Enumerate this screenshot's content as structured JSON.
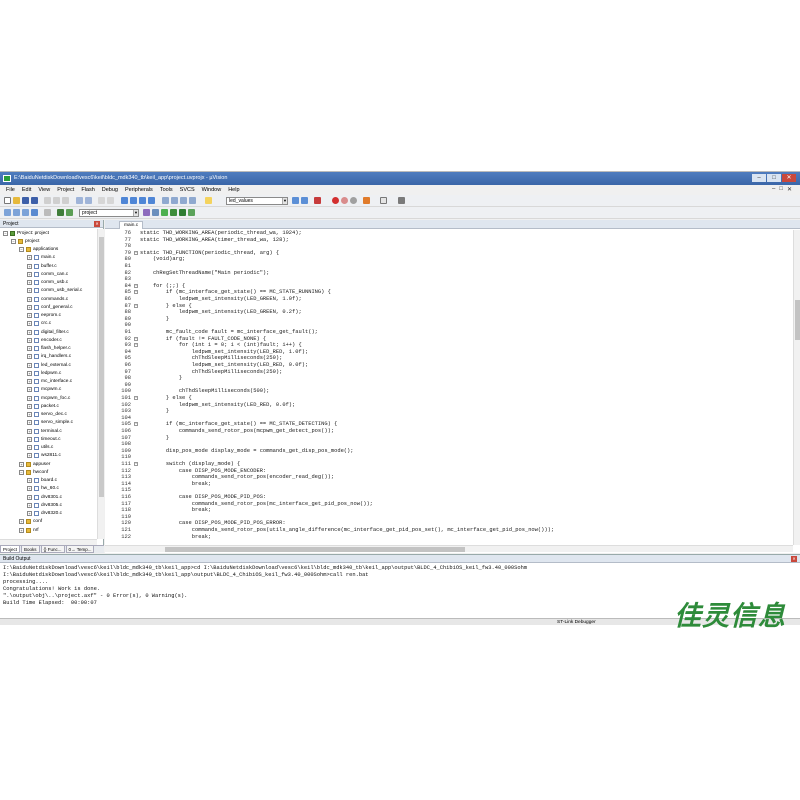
{
  "window": {
    "title": "E:\\BaiduNetdiskDownload\\vesc6\\keil\\bldc_mdk340_tb\\keil_app\\project.uvprojx - µVision",
    "controls": [
      "–",
      "□",
      "✕"
    ],
    "mdi_controls": [
      "–",
      "□",
      "✕"
    ]
  },
  "menu": [
    "File",
    "Edit",
    "View",
    "Project",
    "Flash",
    "Debug",
    "Peripherals",
    "Tools",
    "SVCS",
    "Window",
    "Help"
  ],
  "toolbar": {
    "find_value": "led_values",
    "target_value": "project"
  },
  "project_panel": {
    "title": "Project",
    "tree": [
      {
        "label": "Project: project",
        "level": 0,
        "icon": "proj-icon",
        "expander": "−"
      },
      {
        "label": "project",
        "level": 1,
        "icon": "folder-icon",
        "expander": "−"
      },
      {
        "label": "applications",
        "level": 2,
        "icon": "folder-icon",
        "expander": "−"
      },
      {
        "label": "main.c",
        "level": 3,
        "icon": "file-icon",
        "expander": "+"
      },
      {
        "label": "buffer.c",
        "level": 3,
        "icon": "file-icon",
        "expander": "+"
      },
      {
        "label": "comm_can.c",
        "level": 3,
        "icon": "file-icon",
        "expander": "+"
      },
      {
        "label": "comm_usb.c",
        "level": 3,
        "icon": "file-icon",
        "expander": "+"
      },
      {
        "label": "comm_usb_serial.c",
        "level": 3,
        "icon": "file-icon",
        "expander": "+"
      },
      {
        "label": "commands.c",
        "level": 3,
        "icon": "file-icon",
        "expander": "+"
      },
      {
        "label": "conf_general.c",
        "level": 3,
        "icon": "file-icon",
        "expander": "+"
      },
      {
        "label": "eeprom.c",
        "level": 3,
        "icon": "file-icon",
        "expander": "+"
      },
      {
        "label": "crc.c",
        "level": 3,
        "icon": "file-icon",
        "expander": "+"
      },
      {
        "label": "digital_filter.c",
        "level": 3,
        "icon": "file-icon",
        "expander": "+"
      },
      {
        "label": "encoder.c",
        "level": 3,
        "icon": "file-icon",
        "expander": "+"
      },
      {
        "label": "flash_helper.c",
        "level": 3,
        "icon": "file-icon",
        "expander": "+"
      },
      {
        "label": "irq_handlers.c",
        "level": 3,
        "icon": "file-icon",
        "expander": "+"
      },
      {
        "label": "led_external.c",
        "level": 3,
        "icon": "file-icon",
        "expander": "+"
      },
      {
        "label": "ledpwm.c",
        "level": 3,
        "icon": "file-icon",
        "expander": "+"
      },
      {
        "label": "mc_interface.c",
        "level": 3,
        "icon": "file-icon",
        "expander": "+"
      },
      {
        "label": "mcpwm.c",
        "level": 3,
        "icon": "file-icon",
        "expander": "+"
      },
      {
        "label": "mcpwm_foc.c",
        "level": 3,
        "icon": "file-icon",
        "expander": "+"
      },
      {
        "label": "packet.c",
        "level": 3,
        "icon": "file-icon",
        "expander": "+"
      },
      {
        "label": "servo_dec.c",
        "level": 3,
        "icon": "file-icon",
        "expander": "+"
      },
      {
        "label": "servo_simple.c",
        "level": 3,
        "icon": "file-icon",
        "expander": "+"
      },
      {
        "label": "terminal.c",
        "level": 3,
        "icon": "file-icon",
        "expander": "+"
      },
      {
        "label": "timeout.c",
        "level": 3,
        "icon": "file-icon",
        "expander": "+"
      },
      {
        "label": "utils.c",
        "level": 3,
        "icon": "file-icon",
        "expander": "+"
      },
      {
        "label": "ws2811.c",
        "level": 3,
        "icon": "file-icon",
        "expander": "+"
      },
      {
        "label": "appuser",
        "level": 2,
        "icon": "folder-icon",
        "expander": "+"
      },
      {
        "label": "hwconf",
        "level": 2,
        "icon": "folder-icon",
        "expander": "−"
      },
      {
        "label": "board.c",
        "level": 3,
        "icon": "file-icon",
        "expander": "+"
      },
      {
        "label": "hw_60.c",
        "level": 3,
        "icon": "file-icon",
        "expander": "+"
      },
      {
        "label": "drv8301.c",
        "level": 3,
        "icon": "file-icon",
        "expander": "+"
      },
      {
        "label": "drv8305.c",
        "level": 3,
        "icon": "file-icon",
        "expander": "+"
      },
      {
        "label": "drv8320.c",
        "level": 3,
        "icon": "file-icon",
        "expander": "+"
      },
      {
        "label": "conf",
        "level": 2,
        "icon": "folder-icon",
        "expander": "+"
      },
      {
        "label": "nrf",
        "level": 2,
        "icon": "folder-icon",
        "expander": "+"
      }
    ],
    "tabs": [
      "Project",
      "Books",
      "{} Func...",
      "0→ Temp..."
    ]
  },
  "editor": {
    "active_tab": "main.c",
    "lines": [
      {
        "n": "76",
        "code": "static THD_WORKING_AREA(periodic_thread_wa, 1024);"
      },
      {
        "n": "77",
        "code": "static THD_WORKING_AREA(timer_thread_wa, 128);"
      },
      {
        "n": "78",
        "code": ""
      },
      {
        "n": "79",
        "code": "static THD_FUNCTION(periodic_thread, arg) {",
        "fold": "−"
      },
      {
        "n": "80",
        "code": "    (void)arg;"
      },
      {
        "n": "81",
        "code": ""
      },
      {
        "n": "82",
        "code": "    chRegSetThreadName(\"Main periodic\");"
      },
      {
        "n": "83",
        "code": ""
      },
      {
        "n": "84",
        "code": "    for (;;) {",
        "fold": "−"
      },
      {
        "n": "85",
        "code": "        if (mc_interface_get_state() == MC_STATE_RUNNING) {",
        "fold": "−"
      },
      {
        "n": "86",
        "code": "            ledpwm_set_intensity(LED_GREEN, 1.0f);"
      },
      {
        "n": "87",
        "code": "        } else {",
        "fold": "−"
      },
      {
        "n": "88",
        "code": "            ledpwm_set_intensity(LED_GREEN, 0.2f);"
      },
      {
        "n": "89",
        "code": "        }"
      },
      {
        "n": "90",
        "code": ""
      },
      {
        "n": "91",
        "code": "        mc_fault_code fault = mc_interface_get_fault();"
      },
      {
        "n": "92",
        "code": "        if (fault != FAULT_CODE_NONE) {",
        "fold": "−"
      },
      {
        "n": "93",
        "code": "            for (int i = 0; i < (int)fault; i++) {",
        "fold": "−"
      },
      {
        "n": "94",
        "code": "                ledpwm_set_intensity(LED_RED, 1.0f);"
      },
      {
        "n": "95",
        "code": "                chThdSleepMilliseconds(250);"
      },
      {
        "n": "96",
        "code": "                ledpwm_set_intensity(LED_RED, 0.0f);"
      },
      {
        "n": "97",
        "code": "                chThdSleepMilliseconds(250);"
      },
      {
        "n": "98",
        "code": "            }"
      },
      {
        "n": "99",
        "code": ""
      },
      {
        "n": "100",
        "code": "            chThdSleepMilliseconds(500);"
      },
      {
        "n": "101",
        "code": "        } else {",
        "fold": "−"
      },
      {
        "n": "102",
        "code": "            ledpwm_set_intensity(LED_RED, 0.0f);"
      },
      {
        "n": "103",
        "code": "        }"
      },
      {
        "n": "104",
        "code": ""
      },
      {
        "n": "105",
        "code": "        if (mc_interface_get_state() == MC_STATE_DETECTING) {",
        "fold": "−"
      },
      {
        "n": "106",
        "code": "            commands_send_rotor_pos(mcpwm_get_detect_pos());"
      },
      {
        "n": "107",
        "code": "        }"
      },
      {
        "n": "108",
        "code": ""
      },
      {
        "n": "109",
        "code": "        disp_pos_mode display_mode = commands_get_disp_pos_mode();"
      },
      {
        "n": "110",
        "code": ""
      },
      {
        "n": "111",
        "code": "        switch (display_mode) {",
        "fold": "−"
      },
      {
        "n": "112",
        "code": "            case DISP_POS_MODE_ENCODER:"
      },
      {
        "n": "113",
        "code": "                commands_send_rotor_pos(encoder_read_deg());"
      },
      {
        "n": "114",
        "code": "                break;"
      },
      {
        "n": "115",
        "code": ""
      },
      {
        "n": "116",
        "code": "            case DISP_POS_MODE_PID_POS:"
      },
      {
        "n": "117",
        "code": "                commands_send_rotor_pos(mc_interface_get_pid_pos_now());"
      },
      {
        "n": "118",
        "code": "                break;"
      },
      {
        "n": "119",
        "code": ""
      },
      {
        "n": "120",
        "code": "            case DISP_POS_MODE_PID_POS_ERROR:"
      },
      {
        "n": "121",
        "code": "                commands_send_rotor_pos(utils_angle_difference(mc_interface_get_pid_pos_set(), mc_interface_get_pid_pos_now()));"
      },
      {
        "n": "122",
        "code": "                break;"
      }
    ]
  },
  "build_output": {
    "title": "Build Output",
    "lines": [
      "I:\\BaiduNetdiskDownload\\vesc6\\keil\\bldc_mdk340_tb\\keil_app>cd I:\\BaiduNetdiskDownload\\vesc6\\keil\\bldc_mdk340_tb\\keil_app\\output\\BLDC_4_ChibiOS_keil_fw3.40_000Sohm",
      "I:\\BaiduNetdiskDownload\\vesc6\\keil\\bldc_mdk340_tb\\keil_app\\output\\BLDC_4_ChibiOS_keil_fw3.40_000Sohm>call ren.bat",
      "processing....",
      "Congratulations! Work is done.",
      "\".\\output\\obj\\..\\project.axf\" - 0 Error(s), 0 Warning(s).",
      "Build Time Elapsed:  00:00:07"
    ]
  },
  "status": {
    "debugger": "ST-Link Debugger"
  },
  "watermark": "佳灵信息",
  "colors": {
    "titlebar": "#3a66a8",
    "watermark": "#2e8b3a"
  }
}
